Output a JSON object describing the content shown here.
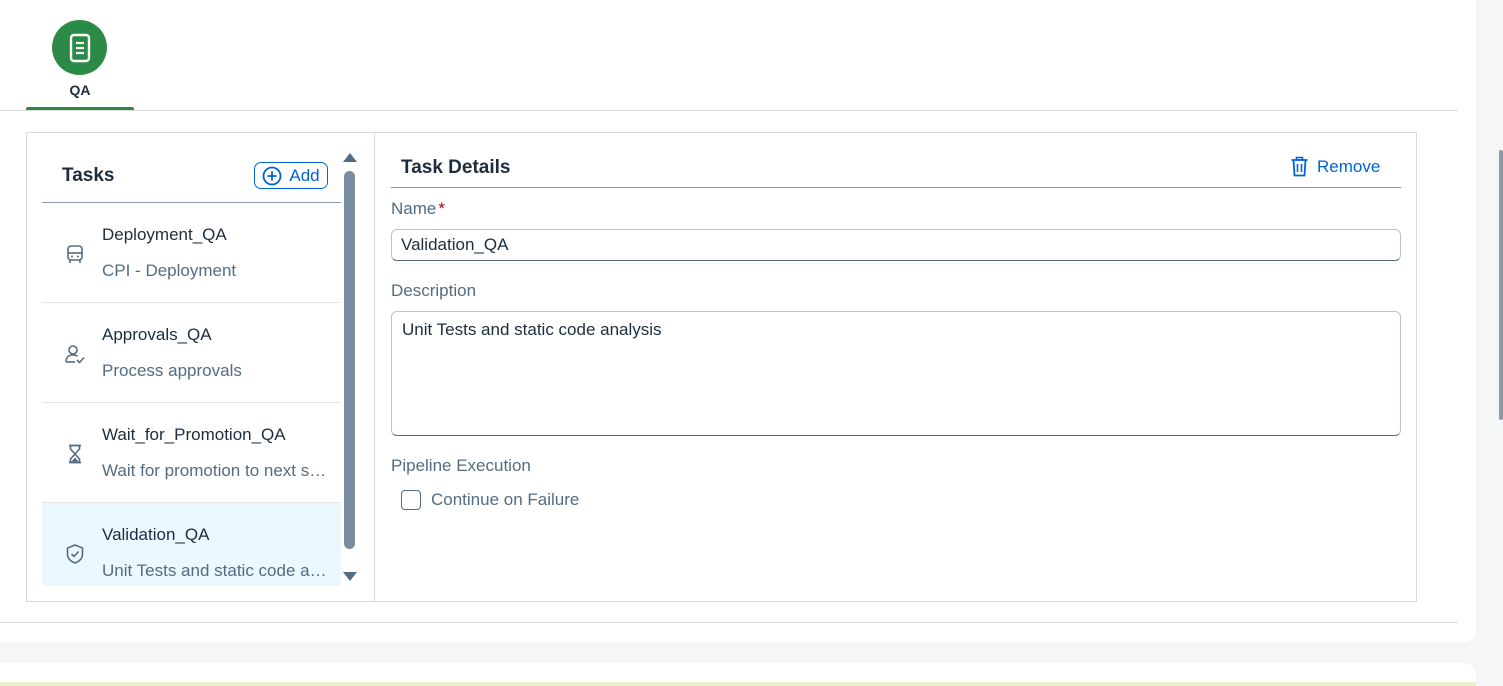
{
  "stage": {
    "label": "QA",
    "icon": "document-icon",
    "color": "#2b8a45"
  },
  "tasks_panel": {
    "title": "Tasks",
    "add_label": "Add",
    "items": [
      {
        "name": "Deployment_QA",
        "description": "CPI - Deployment",
        "icon": "bus-icon"
      },
      {
        "name": "Approvals_QA",
        "description": "Process approvals",
        "icon": "user-check-icon"
      },
      {
        "name": "Wait_for_Promotion_QA",
        "description": "Wait for promotion to next stage",
        "icon": "hourglass-icon"
      },
      {
        "name": "Validation_QA",
        "description": "Unit Tests and static code analysis",
        "icon": "shield-check-icon",
        "selected": true
      }
    ]
  },
  "details": {
    "title": "Task Details",
    "remove_label": "Remove",
    "name_label": "Name",
    "required_mark": "*",
    "name_value": "Validation_QA",
    "description_label": "Description",
    "description_value": "Unit Tests and static code analysis",
    "pipeline_label": "Pipeline Execution",
    "continue_label": "Continue on Failure",
    "continue_checked": false
  },
  "colors": {
    "accent": "#0064d9",
    "selected_row": "#ebf8ff",
    "text": "#1d2d3e",
    "muted": "#556b82"
  }
}
